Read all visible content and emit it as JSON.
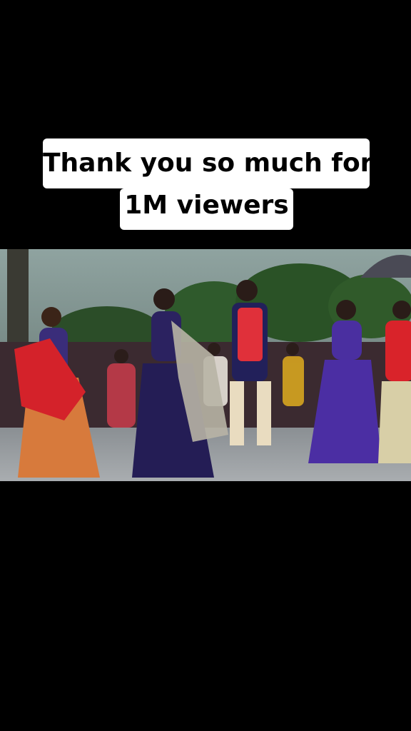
{
  "caption": {
    "line1": "Thank you so much for",
    "line2": "1M viewers"
  },
  "video": {
    "scene": "video-frame"
  },
  "colors": {
    "background": "#000000",
    "caption_bg": "#ffffff",
    "caption_text": "#000000"
  }
}
